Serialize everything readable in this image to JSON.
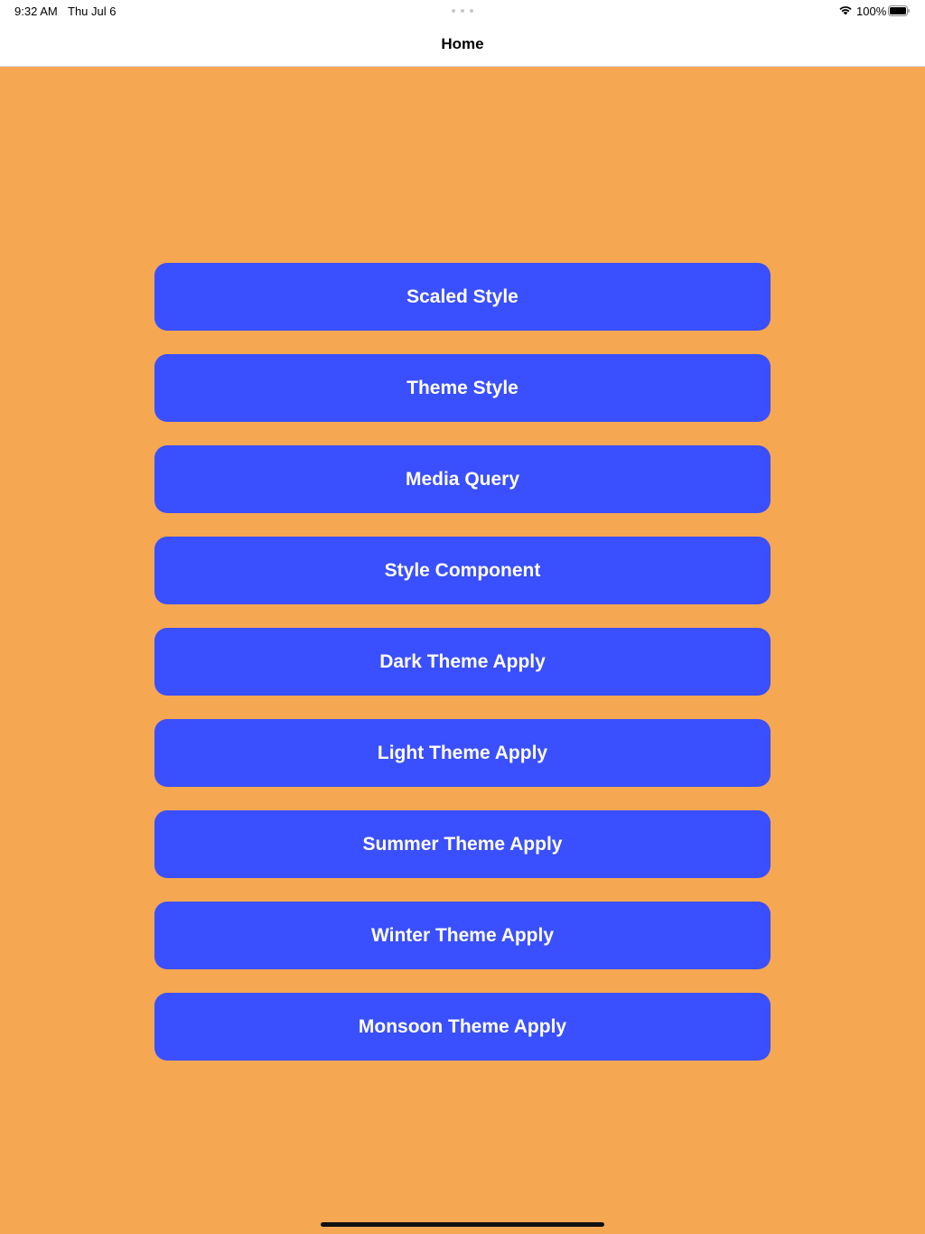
{
  "status_bar": {
    "time": "9:32 AM",
    "date": "Thu Jul 6",
    "battery_percent": "100%",
    "battery_level": 1.0
  },
  "nav": {
    "title": "Home"
  },
  "buttons": [
    {
      "label": "Scaled Style"
    },
    {
      "label": "Theme Style"
    },
    {
      "label": "Media Query"
    },
    {
      "label": "Style Component"
    },
    {
      "label": "Dark Theme Apply"
    },
    {
      "label": "Light Theme Apply"
    },
    {
      "label": "Summer Theme Apply"
    },
    {
      "label": "Winter Theme Apply"
    },
    {
      "label": "Monsoon Theme Apply"
    }
  ],
  "colors": {
    "background": "#f6a752",
    "button": "#3a4ffd",
    "button_text": "#ffffff"
  },
  "icons": {
    "wifi": "wifi-icon",
    "battery": "battery-icon",
    "multitask": "multitask-dots-icon"
  }
}
